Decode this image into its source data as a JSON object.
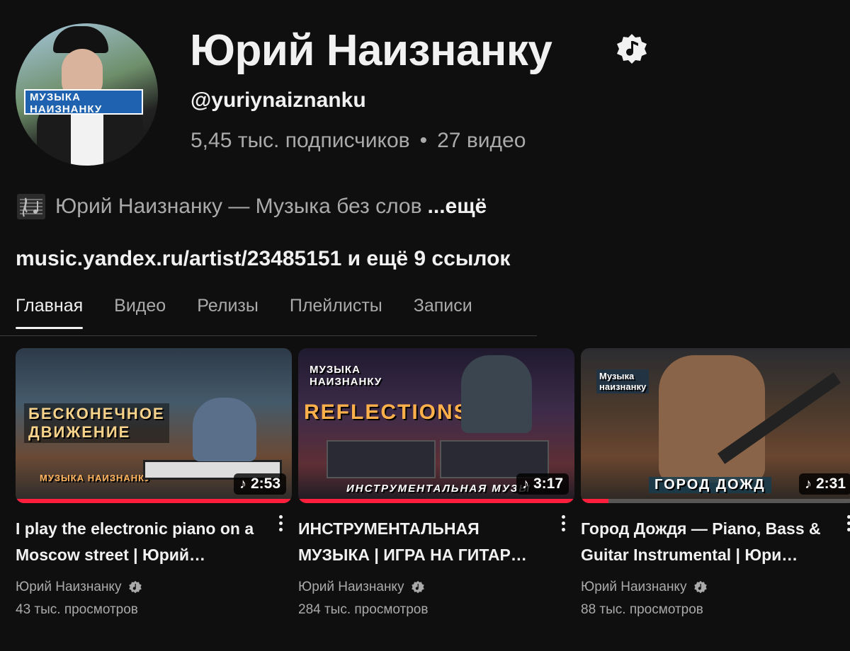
{
  "channel": {
    "avatar_badge_line1": "МУЗЫКА",
    "avatar_badge_line2": "НАИЗНАНКУ",
    "name": "Юрий Наизнанку",
    "handle": "@yuriynaiznanku",
    "subscribers": "5,45 тыс. подписчиков",
    "separator": "•",
    "video_count": "27 видео",
    "description": "Юрий Наизнанку — Музыка без слов",
    "description_more": "...ещё",
    "links": "music.yandex.ru/artist/23485151 и ещё 9 ссылок"
  },
  "tabs": [
    {
      "label": "Главная",
      "active": true
    },
    {
      "label": "Видео",
      "active": false
    },
    {
      "label": "Релизы",
      "active": false
    },
    {
      "label": "Плейлисты",
      "active": false
    },
    {
      "label": "Записи",
      "active": false
    }
  ],
  "videos": [
    {
      "thumb_text_line1": "БЕСКОНЕЧНОЕ",
      "thumb_text_line2": "ДВИЖЕНИЕ",
      "thumb_text_bottom": "МУЗЫКА НАИЗНАНКУ",
      "duration": "2:53",
      "progress_fraction": 1.0,
      "title": "I play the electronic piano on a Moscow street | Юрий…",
      "author": "Юрий Наизнанку",
      "views": "43 тыс. просмотров"
    },
    {
      "thumb_text_line1": "МУЗЫКА",
      "thumb_text_line2": "НАИЗНАНКУ",
      "thumb_text_main": "REFLECTIONS",
      "thumb_text_bottom": "ИНСТРУМЕНТАЛЬНАЯ МУЗЫ",
      "duration": "3:17",
      "progress_fraction": 1.0,
      "title": "ИНСТРУМЕНТАЛЬНАЯ МУЗЫКА | ИГРА НА ГИТАР…",
      "author": "Юрий Наизнанку",
      "views": "284 тыс. просмотров"
    },
    {
      "thumb_text_line1": "Музыка",
      "thumb_text_line2": "наизнанку",
      "thumb_text_bottom": "ГОРОД ДОЖД",
      "duration": "2:31",
      "progress_fraction": 0.1,
      "title": "Город Дождя — Piano, Bass & Guitar Instrumental | Юри…",
      "author": "Юрий Наизнанку",
      "views": "88 тыс. просмотров"
    }
  ],
  "colors": {
    "background": "#0f0f0f",
    "text_primary": "#f1f1f1",
    "text_secondary": "#aaaaaa",
    "progress": "#ff1f3d",
    "badge_blue": "#1f63b0"
  },
  "icons": {
    "verified": "music-note-badge-icon",
    "more": "kebab-menu-icon",
    "duration": "music-note-icon",
    "description": "music-sheet-icon"
  }
}
